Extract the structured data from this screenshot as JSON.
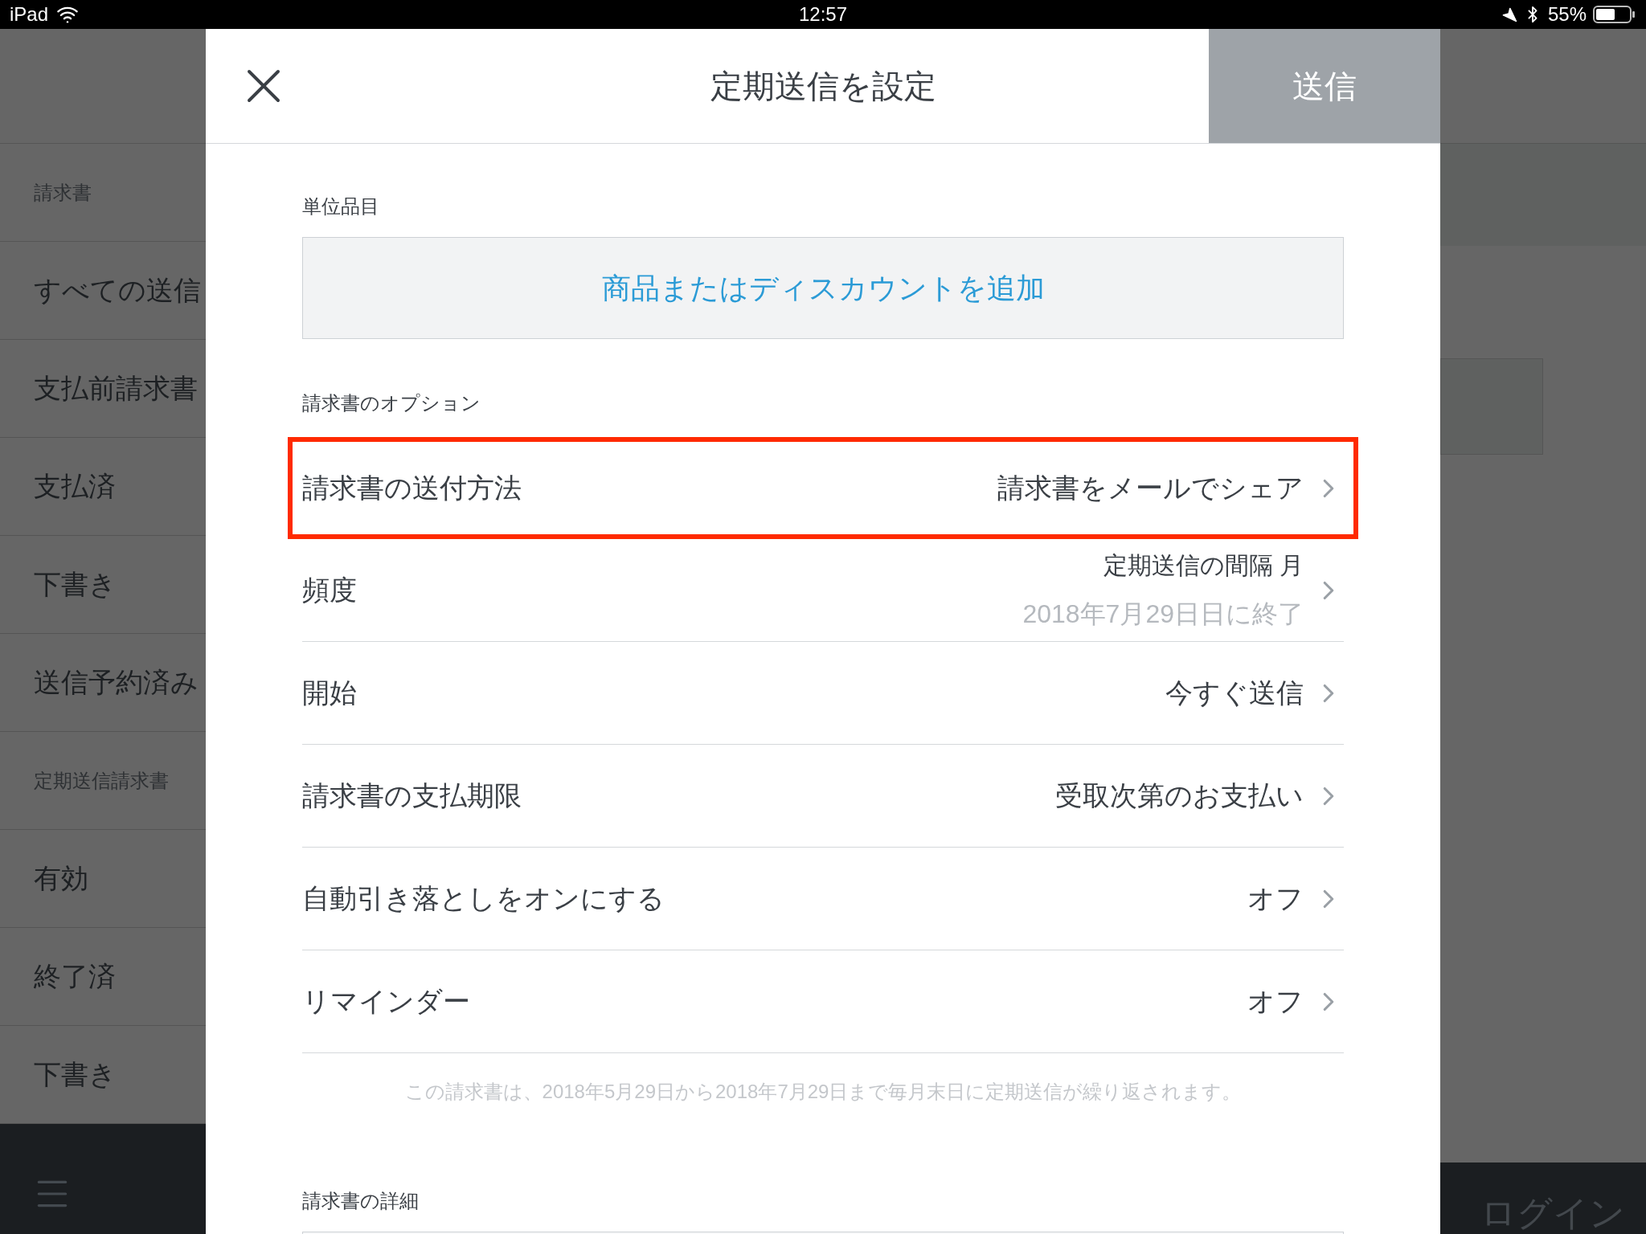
{
  "status_bar": {
    "device": "iPad",
    "time": "12:57",
    "battery": "55%"
  },
  "sidebar": {
    "items": [
      {
        "kind": "section",
        "label": "請求書"
      },
      {
        "kind": "item",
        "label": "すべての送信"
      },
      {
        "kind": "item",
        "label": "支払前請求書"
      },
      {
        "kind": "item",
        "label": "支払済"
      },
      {
        "kind": "item",
        "label": "下書き"
      },
      {
        "kind": "item",
        "label": "送信予約済み"
      },
      {
        "kind": "section",
        "label": "定期送信請求書"
      },
      {
        "kind": "item",
        "label": "有効"
      },
      {
        "kind": "item",
        "label": "終了済"
      },
      {
        "kind": "item",
        "label": "下書き"
      }
    ]
  },
  "bottom_bar": {
    "login": "ログイン"
  },
  "dialog": {
    "title": "定期送信を設定",
    "send_button": "送信",
    "line_items": {
      "heading": "単位品目",
      "add_button": "商品またはディスカウントを追加"
    },
    "options": {
      "heading": "請求書のオプション",
      "rows": [
        {
          "label": "請求書の送付方法",
          "value": "請求書をメールでシェア",
          "highlighted": true
        },
        {
          "label": "頻度",
          "value": "定期送信の間隔 月",
          "detail": "2018年7月29日日に終了",
          "highlighted": false
        },
        {
          "label": "開始",
          "value": "今すぐ送信",
          "highlighted": false
        },
        {
          "label": "請求書の支払期限",
          "value": "受取次第のお支払い",
          "highlighted": false
        },
        {
          "label": "自動引き落としをオンにする",
          "value": "オフ",
          "highlighted": false
        },
        {
          "label": "リマインダー",
          "value": "オフ",
          "highlighted": false
        }
      ],
      "note": "この請求書は、2018年5月29日から2018年7月29日まで毎月末日に定期送信が繰り返されます。"
    },
    "details": {
      "heading": "請求書の詳細"
    }
  }
}
